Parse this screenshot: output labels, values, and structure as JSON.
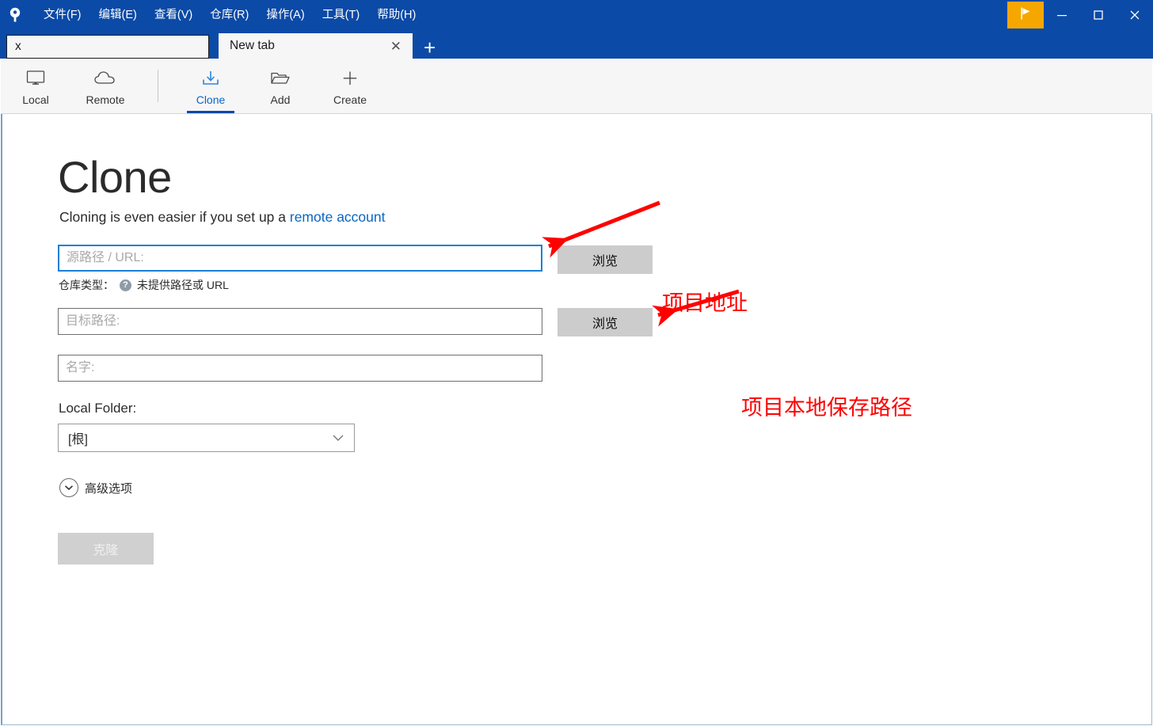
{
  "window": {
    "logo_icon": "sourcetree-logo-icon",
    "flag_button_icon": "flag-icon",
    "minimize_label": "─",
    "maximize_label": "□",
    "close_label": "✕",
    "accent_blue": "#0b4aa6",
    "flag_button_color": "#f5a700"
  },
  "menubar": {
    "items": [
      {
        "label": "文件(F)"
      },
      {
        "label": "编辑(E)"
      },
      {
        "label": "查看(V)"
      },
      {
        "label": "仓库(R)"
      },
      {
        "label": "操作(A)"
      },
      {
        "label": "工具(T)"
      },
      {
        "label": "帮助(H)"
      }
    ]
  },
  "tabs": {
    "items": [
      {
        "label": "x",
        "active": false
      },
      {
        "label": "New tab",
        "active": true,
        "close_label": "✕"
      }
    ],
    "add_label": "+"
  },
  "toolbar": {
    "left_group": [
      {
        "label": "Local",
        "icon": "monitor-icon",
        "active": false
      },
      {
        "label": "Remote",
        "icon": "cloud-icon",
        "active": false
      }
    ],
    "right_group": [
      {
        "label": "Clone",
        "icon": "download-icon",
        "active": true
      },
      {
        "label": "Add",
        "icon": "folder-icon",
        "active": false
      },
      {
        "label": "Create",
        "icon": "plus-icon",
        "active": false
      }
    ],
    "active_color": "#0b66c3"
  },
  "main": {
    "title": "Clone",
    "subtitle_prefix": "Cloning is even easier if you set up a ",
    "subtitle_link": "remote account",
    "source_field": {
      "value": "",
      "placeholder": "源路径 / URL:",
      "focused": true
    },
    "repo_type": {
      "label": "仓库类型：",
      "help_icon": "help-icon",
      "help_glyph": "?",
      "status": "未提供路径或 URL"
    },
    "destination_field": {
      "value": "",
      "placeholder": "目标路径:"
    },
    "name_field": {
      "value": "",
      "placeholder": "名字:"
    },
    "browse_button_1": "浏览",
    "browse_button_2": "浏览",
    "local_folder_label": "Local Folder:",
    "local_folder_value": "[根]",
    "advanced_label": "高级选项",
    "advanced_icon": "chevron-down-circle-icon",
    "clone_button": "克隆"
  },
  "annotations": {
    "color": "#ff0000",
    "items": [
      {
        "text": "项目地址"
      },
      {
        "text": "项目本地保存路径"
      }
    ]
  }
}
